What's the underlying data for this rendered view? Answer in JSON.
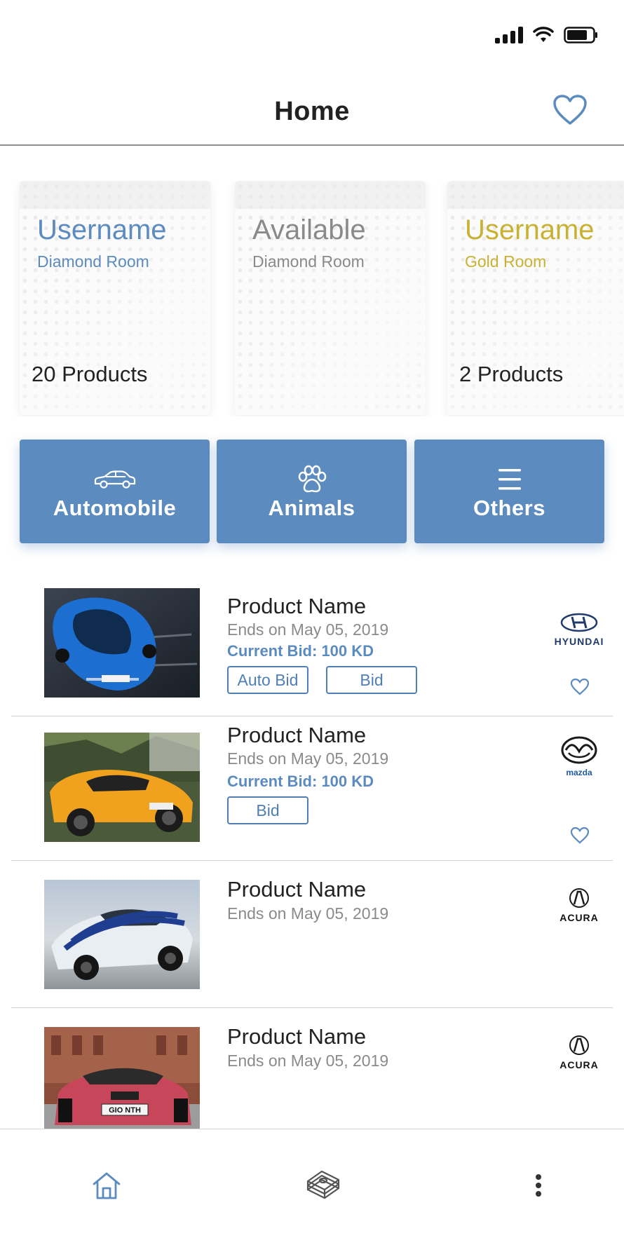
{
  "header": {
    "title": "Home"
  },
  "rooms": [
    {
      "title": "Username",
      "subtitle": "Diamond Room",
      "count": "20 Products",
      "title_color": "#5b8bbf",
      "subtitle_color": "#5b8bbf"
    },
    {
      "title": "Available",
      "subtitle": "Diamond Room",
      "count": "",
      "title_color": "#8a8a8a",
      "subtitle_color": "#8a8a8a"
    },
    {
      "title": "Username",
      "subtitle": "Gold Room",
      "count": "2 Products",
      "title_color": "#c9b233",
      "subtitle_color": "#c9b233"
    }
  ],
  "categories": [
    {
      "label": "Automobile",
      "icon": "car-icon"
    },
    {
      "label": "Animals",
      "icon": "paw-icon"
    },
    {
      "label": "Others",
      "icon": "menu-icon"
    }
  ],
  "products": [
    {
      "name": "Product Name",
      "date": "Ends on May 05, 2019",
      "bid": "Current Bid: 100 KD",
      "buttons": [
        "Auto Bid",
        "Bid"
      ],
      "brand": "HYUNDAI",
      "image": "blue-car-photo"
    },
    {
      "name": "Product Name",
      "date": "Ends on May 05, 2019",
      "bid": "Current Bid: 100 KD",
      "buttons": [
        "Bid"
      ],
      "brand": "mazda",
      "image": "orange-car-photo"
    },
    {
      "name": "Product Name",
      "date": "Ends on May 05, 2019",
      "brand": "ACURA",
      "image": "white-car-photo"
    },
    {
      "name": "Product Name",
      "date": "Ends on May 05, 2019",
      "brand": "ACURA",
      "image": "red-car-photo",
      "plate": "GIO NTH"
    }
  ],
  "nav": [
    "home-icon",
    "money-stack-icon",
    "more-vertical-icon"
  ],
  "colors": {
    "accent": "#5b8bbf",
    "gold": "#c9b233",
    "text": "#222222",
    "muted": "#8a8a8a"
  }
}
